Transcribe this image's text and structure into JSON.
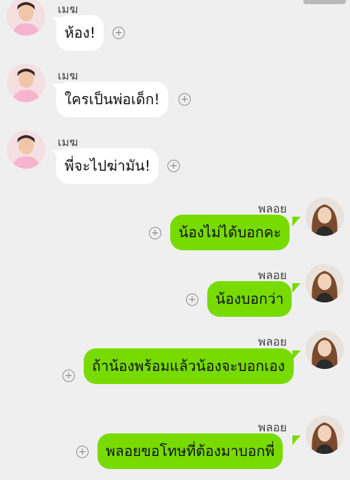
{
  "messages": [
    {
      "sender": "เมฆ",
      "text": "ห้อง!",
      "side": "in"
    },
    {
      "sender": "เมฆ",
      "text": "ใครเป็นพ่อเด็ก!",
      "side": "in"
    },
    {
      "sender": "เมฆ",
      "text": "พี่จะไปฆ่ามัน!",
      "side": "in"
    },
    {
      "sender": "พลอย",
      "text": "น้องไม่ได้บอกคะ",
      "side": "out"
    },
    {
      "sender": "พลอย",
      "text": "น้องบอกว่า",
      "side": "out"
    },
    {
      "sender": "พลอย",
      "text": "ถ้าน้องพร้อมแล้วน้องจะบอกเอง",
      "side": "out"
    },
    {
      "sender": "พลอย",
      "text": "พลอยขอโทษที่ต้องมาบอกพี่",
      "side": "out"
    }
  ],
  "icons": {
    "add_reaction": "plus-circle-icon"
  },
  "colors": {
    "background": "#efefef",
    "outgoing_bubble": "#78db00",
    "incoming_bubble": "#ffffff"
  }
}
